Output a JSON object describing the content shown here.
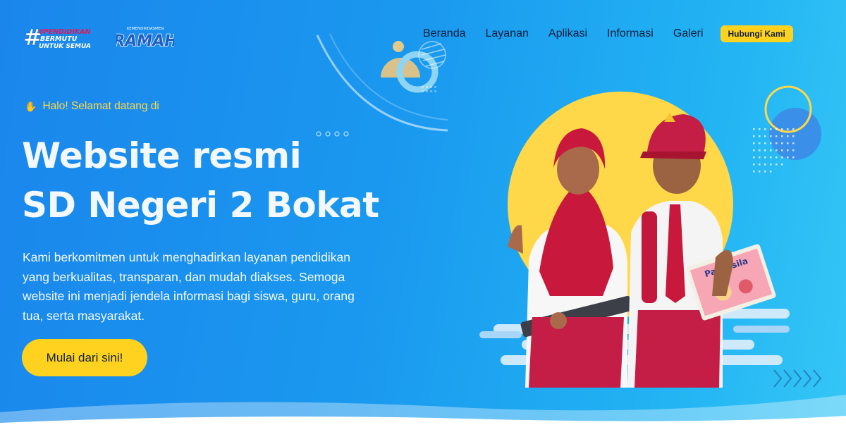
{
  "header": {
    "logo_main_text": [
      "#PENDIDIKAN",
      "BERMUTU",
      "UNTUK SEMUA"
    ],
    "logo_second_text": "RAMAH",
    "logo_second_tagline": "KEMENDIKDASMEN",
    "nav": [
      {
        "label": "Beranda"
      },
      {
        "label": "Layanan"
      },
      {
        "label": "Aplikasi"
      },
      {
        "label": "Informasi"
      },
      {
        "label": "Galeri"
      }
    ],
    "contact_button": "Hubungi Kami"
  },
  "hero": {
    "greeting": "Halo! Selamat datang di",
    "greeting_icon": "waving-hand-icon",
    "title_line1": "Website resmi",
    "title_line2": "SD Negeri 2 Bokat",
    "description": "Kami berkomitmen untuk menghadirkan layanan pendidikan yang berkualitas, transparan, dan mudah diakses. Semoga website ini menjadi jendela informasi bagi siswa, guru, orang tua, serta masyarakat.",
    "cta_label": "Mulai dari sini!",
    "book_title": "Pancasila"
  },
  "colors": {
    "hero_gradient_start": "#1a86ec",
    "hero_gradient_end": "#35c6f6",
    "accent_yellow": "#ffd21f",
    "nav_text": "#0e1f3d",
    "title_text": "#f3f8ff"
  }
}
